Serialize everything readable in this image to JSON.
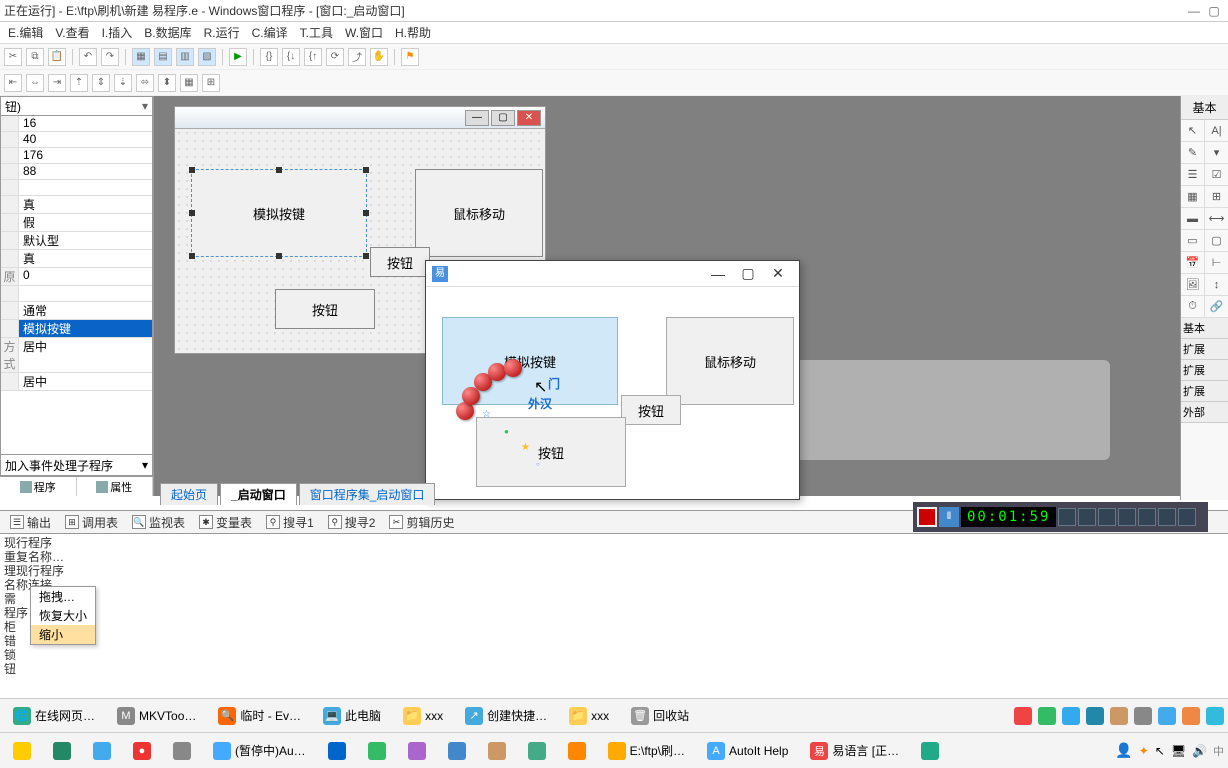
{
  "title": "正在运行] - E:\\ftp\\刷机\\新建 易程序.e - Windows窗口程序 - [窗口:_启动窗口]",
  "menu": [
    "E.编辑",
    "V.查看",
    "I.插入",
    "B.数据库",
    "R.运行",
    "C.编译",
    "T.工具",
    "W.窗口",
    "H.帮助"
  ],
  "properties": {
    "selector": "钮)",
    "rows": [
      "16",
      "40",
      "176",
      "88",
      "",
      "真",
      "假",
      "默认型",
      "真",
      "0",
      "",
      "通常",
      "模拟按键",
      "居中",
      "居中"
    ],
    "selected_index": 12,
    "add_event": "加入事件处理子程序"
  },
  "left_tabs": [
    "程序",
    "属性"
  ],
  "designer": {
    "buttons": {
      "sim_key": "模拟按键",
      "mouse_move": "鼠标移动",
      "btn1": "按钮",
      "btn2": "按钮"
    }
  },
  "run_window": {
    "sim_key": "模拟按键",
    "mouse_move": "鼠标移动",
    "btn1": "按钮",
    "btn2": "按钮",
    "cursor_text1": "门",
    "cursor_text2": "外汉"
  },
  "designer_tabs": [
    "起始页",
    "_启动窗口",
    "窗口程序集_启动窗口"
  ],
  "out_tabs": [
    "输出",
    "调用表",
    "监视表",
    "变量表",
    "搜寻1",
    "搜寻2",
    "剪辑历史"
  ],
  "output_lines": [
    "现行程序",
    "重复名称…",
    "理现行程序",
    "名称连接…",
    "需",
    "程序",
    "柜",
    "错",
    "锁",
    "钮"
  ],
  "output_popup": {
    "l1": "拖拽…",
    "l2": "恢复大小",
    "l3": "缩小"
  },
  "recorder": {
    "time": "00:01:59"
  },
  "right_panel": {
    "header": "基本",
    "sections": [
      "基本",
      "扩展",
      "扩展",
      "扩展",
      "外部"
    ]
  },
  "taskbar1": [
    {
      "icon": "🌐",
      "label": "在线网页…",
      "bg": "#3a8"
    },
    {
      "icon": "M",
      "label": "MKVToo…",
      "bg": "#888"
    },
    {
      "icon": "🔍",
      "label": "临时 - Ev…",
      "bg": "#f60"
    },
    {
      "icon": "💻",
      "label": "此电脑",
      "bg": "#4ad"
    },
    {
      "icon": "📁",
      "label": "xxx",
      "bg": "#fc5"
    },
    {
      "icon": "↗",
      "label": "创建快捷…",
      "bg": "#4ad"
    },
    {
      "icon": "📁",
      "label": "xxx",
      "bg": "#fc5"
    },
    {
      "icon": "🗑",
      "label": "回收站",
      "bg": "#999"
    }
  ],
  "taskbar2": [
    {
      "icon": "",
      "bg": "#fc0"
    },
    {
      "icon": "",
      "bg": "#286"
    },
    {
      "icon": "",
      "bg": "#4ae"
    },
    {
      "icon": "●",
      "bg": "#e33"
    },
    {
      "icon": "",
      "bg": "#888"
    },
    {
      "label": "(暂停中)Au…",
      "bg": "#4af"
    },
    {
      "icon": "",
      "bg": "#06c"
    },
    {
      "icon": "",
      "bg": "#3b6"
    },
    {
      "icon": "",
      "bg": "#a6c"
    },
    {
      "icon": "",
      "bg": "#48c"
    },
    {
      "icon": "",
      "bg": "#c96"
    },
    {
      "icon": "",
      "bg": "#4a8"
    },
    {
      "icon": "",
      "bg": "#f80"
    },
    {
      "label": "E:\\ftp\\刷…",
      "bg": "#fa0"
    },
    {
      "icon": "A",
      "label": "AutoIt Help",
      "bg": "#4af"
    },
    {
      "icon": "易",
      "label": "易语言 [正…",
      "bg": "#e44"
    },
    {
      "icon": "",
      "bg": "#2a8"
    }
  ]
}
